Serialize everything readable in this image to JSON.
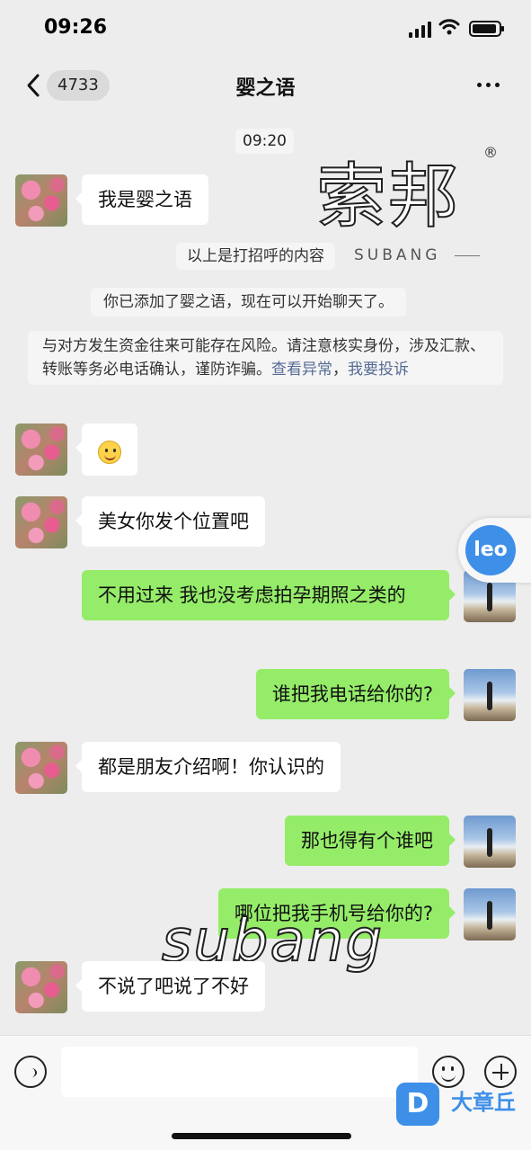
{
  "status_bar": {
    "time": "09:26"
  },
  "nav": {
    "unread_count": "4733",
    "title": "婴之语"
  },
  "timestamp": "09:20",
  "watermark": {
    "brand": "索邦",
    "brand_sub": "SUBANG",
    "reg_mark": "®",
    "script": "subang"
  },
  "system_notes": {
    "greeting": "以上是打招呼的内容",
    "added": "你已添加了婴之语，现在可以开始聊天了。",
    "risk_text": "与对方发生资金往来可能存在风险。请注意核实身份，涉及汇款、转账等务必电话确认，谨防诈骗。",
    "risk_link_view": "查看异常",
    "risk_sep": "，",
    "risk_link_report": "我要投诉"
  },
  "messages": [
    {
      "from": "peer",
      "text": "我是婴之语"
    },
    {
      "from": "peer",
      "emoji": "smile-emoji"
    },
    {
      "from": "peer",
      "text": "美女你发个位置吧"
    },
    {
      "from": "self",
      "text": "不用过来    我也没考虑拍孕期照之类的"
    },
    {
      "from": "self",
      "text": "谁把我电话给你的?"
    },
    {
      "from": "peer",
      "text": "都是朋友介绍啊！你认识的"
    },
    {
      "from": "self",
      "text": "那也得有个谁吧"
    },
    {
      "from": "self",
      "text": "哪位把我手机号给你的?"
    },
    {
      "from": "peer",
      "text": "不说了吧说了不好"
    }
  ],
  "floating_button": {
    "label": "leo"
  },
  "corner_watermark": {
    "logo": "D",
    "text": "大章丘"
  },
  "colors": {
    "outgoing_bubble": "#95ec69",
    "incoming_bubble": "#ffffff",
    "background": "#ededed",
    "link": "#576b95"
  }
}
